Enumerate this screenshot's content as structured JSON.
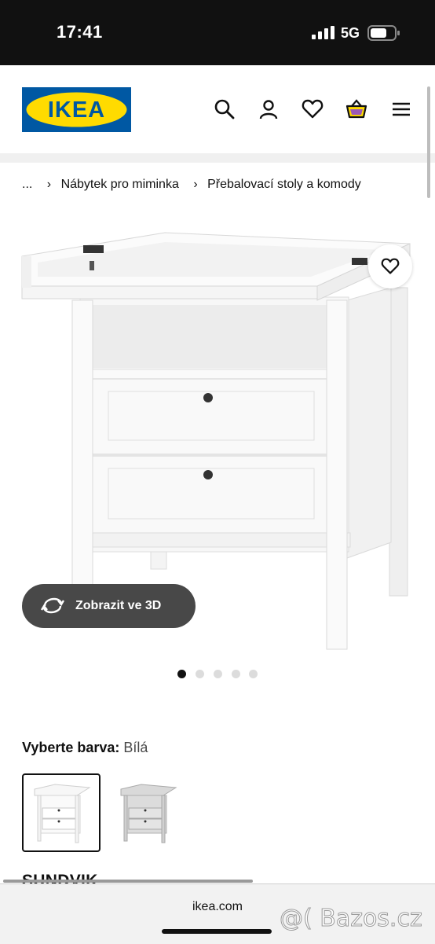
{
  "status_bar": {
    "time": "17:41",
    "network": "5G"
  },
  "header": {
    "logo_text": "IKEA",
    "brand_colors": {
      "blue": "#0058A3",
      "yellow": "#FFDB00"
    },
    "icons": [
      "search-icon",
      "account-icon",
      "heart-icon",
      "basket-icon",
      "menu-icon"
    ]
  },
  "breadcrumb": {
    "items": [
      "...",
      "Nábytek pro miminka",
      "Přebalovací stoly a komody"
    ]
  },
  "gallery": {
    "total_images": 5,
    "active_index": 0,
    "view3d_label": "Zobrazit ve 3D"
  },
  "color_selector": {
    "label": "Vyberte barva:",
    "selected": "Bílá",
    "options": [
      {
        "color": "#ffffff"
      },
      {
        "color": "#c8c8c8"
      }
    ]
  },
  "product": {
    "name": "SUNDVIK"
  },
  "browser": {
    "url": "ikea.com"
  },
  "watermark": "@( Bazos.cz"
}
